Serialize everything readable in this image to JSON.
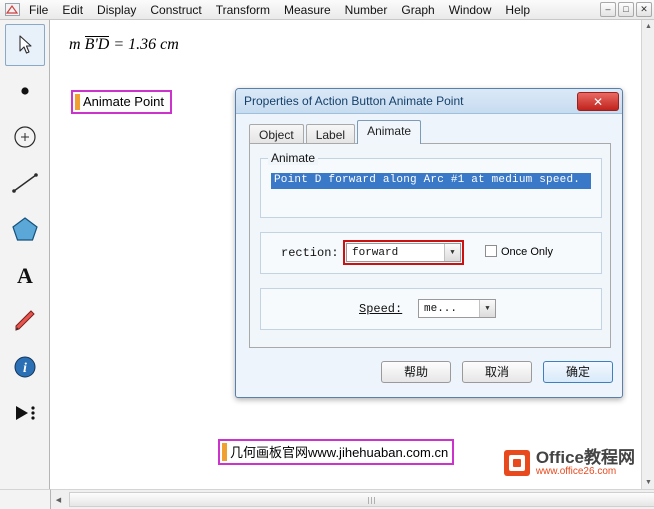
{
  "menubar": {
    "app_icon": "geometry-sketchpad-icon",
    "items": [
      "File",
      "Edit",
      "Display",
      "Construct",
      "Transform",
      "Measure",
      "Number",
      "Graph",
      "Window",
      "Help"
    ],
    "window_buttons": [
      {
        "name": "minimize-button",
        "glyph": "–"
      },
      {
        "name": "maximize-button",
        "glyph": "□"
      },
      {
        "name": "close-button",
        "glyph": "✕"
      }
    ]
  },
  "toolbar": {
    "tools": [
      {
        "name": "arrow-select-tool",
        "icon": "arrow-cursor-icon",
        "selected": true
      },
      {
        "name": "point-tool",
        "icon": "point-icon",
        "selected": false
      },
      {
        "name": "compass-circle-tool",
        "icon": "circle-icon",
        "selected": false
      },
      {
        "name": "straightedge-tool",
        "icon": "line-segment-icon",
        "selected": false
      },
      {
        "name": "polygon-tool",
        "icon": "pentagon-icon",
        "selected": false
      },
      {
        "name": "text-tool",
        "icon": "letter-a-icon",
        "selected": false
      },
      {
        "name": "marker-pen-tool",
        "icon": "pencil-icon",
        "selected": false
      },
      {
        "name": "information-tool",
        "icon": "info-icon",
        "selected": false
      },
      {
        "name": "custom-tool",
        "icon": "play-triangle-icon",
        "selected": false
      }
    ]
  },
  "canvas": {
    "measurement": {
      "prefix": "m",
      "segment": "B'D",
      "equals": "=",
      "value": "1.36 cm"
    },
    "animate_button_label": "Animate Point",
    "watermark_label": "几何画板官网www.jihehuaban.com.cn",
    "logo": {
      "title": "Office教程网",
      "subtitle": "www.office26.com"
    }
  },
  "dialog": {
    "title": "Properties of Action Button Animate Point",
    "close_label": "✕",
    "tabs": [
      {
        "label": "Object",
        "active": false
      },
      {
        "label": "Label",
        "active": false
      },
      {
        "label": "Animate",
        "active": true
      }
    ],
    "animate_group_label": "Animate",
    "animate_description": "Point D forward along Arc #1 at medium speed.",
    "direction_label": "rection:",
    "direction_value": "forward",
    "once_only_label": "Once Only",
    "once_only_checked": false,
    "speed_label": "Speed:",
    "speed_value": "me...",
    "buttons": [
      {
        "name": "help-button",
        "label": "帮助"
      },
      {
        "name": "cancel-button",
        "label": "取消"
      },
      {
        "name": "ok-button",
        "label": "确定"
      }
    ]
  }
}
